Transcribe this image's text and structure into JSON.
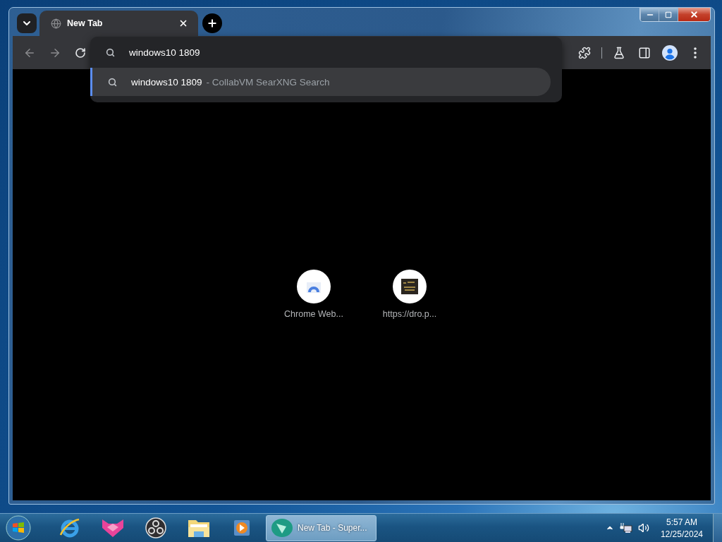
{
  "tab": {
    "title": "New Tab",
    "selected": true
  },
  "omnibox": {
    "value": "windows10 1809"
  },
  "suggestions": [
    {
      "query": "windows10 1809",
      "separator": "-",
      "source": "CollabVM SearXNG Search",
      "selected": true
    }
  ],
  "shortcuts": [
    {
      "title": "Chrome Web..."
    },
    {
      "title": "https://dro.p..."
    }
  ],
  "taskbar": {
    "tasks": [
      {
        "label": "New Tab - Super...",
        "selected": true
      }
    ],
    "clock": {
      "time": "5:57 AM",
      "date": "12/25/2024"
    }
  }
}
